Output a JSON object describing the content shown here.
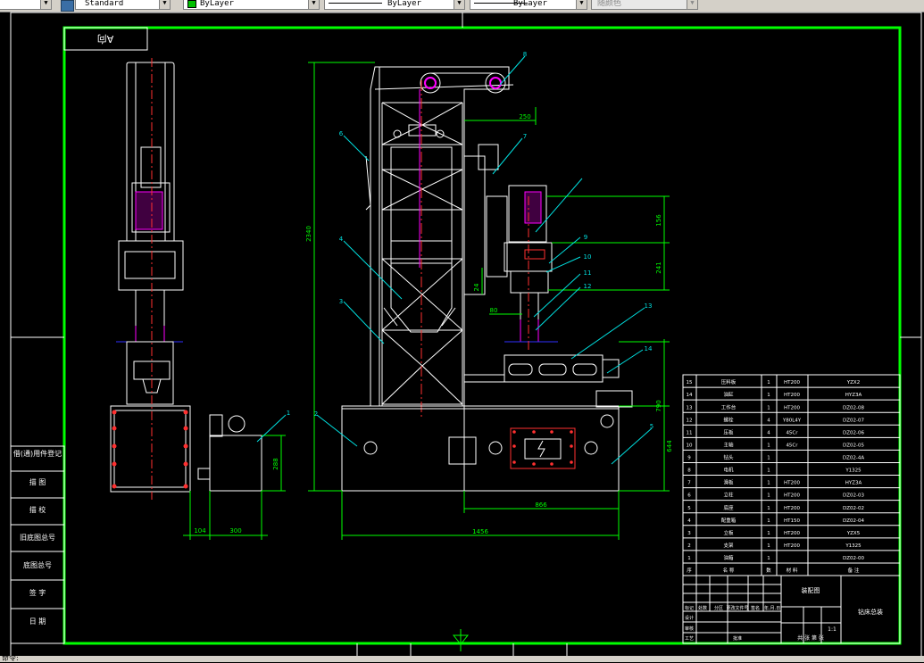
{
  "toolbar": {
    "left_combo": "",
    "text_style": "Standard",
    "layer": "ByLayer",
    "linetype": "ByLayer",
    "lineweight": "ByLayer",
    "plot_style": "随颜色"
  },
  "drawing": {
    "view_label": "A向",
    "part_callouts": [
      "1",
      "2",
      "3",
      "4",
      "5",
      "6",
      "7",
      "8",
      "9",
      "10",
      "11",
      "12",
      "13",
      "14"
    ],
    "dimensions": {
      "total_height": "2340",
      "upper_offset": "250",
      "dim_156": "156",
      "dim_241": "241",
      "dim_24": "24",
      "dim_80": "80",
      "dim_790": "790",
      "dim_644": "644",
      "dim_866": "866",
      "dim_1456": "1456",
      "dim_288": "288",
      "dim_104": "104",
      "dim_300": "300"
    },
    "revision_block": [
      "借(通)用件登记",
      "描 图",
      "描 校",
      "旧底图总号",
      "底图总号",
      "签 字",
      "日 期"
    ],
    "bom_rows": [
      {
        "no": "15",
        "name": "压料板",
        "qty": "1",
        "material": "HT200",
        "remark": "YZX2"
      },
      {
        "no": "14",
        "name": "油缸",
        "qty": "1",
        "material": "HT200",
        "remark": "HYZ3A"
      },
      {
        "no": "13",
        "name": "工作台",
        "qty": "1",
        "material": "HT200",
        "remark": "DZ02-08"
      },
      {
        "no": "12",
        "name": "螺栓",
        "qty": "4",
        "material": "Y80L4Y",
        "remark": "DZ02-07"
      },
      {
        "no": "11",
        "name": "压板",
        "qty": "4",
        "material": "45Cr",
        "remark": "DZ02-06"
      },
      {
        "no": "10",
        "name": "主轴",
        "qty": "1",
        "material": "45Cr",
        "remark": "DZ02-05"
      },
      {
        "no": "9",
        "name": "钻头",
        "qty": "1",
        "material": "",
        "remark": "DZ02-4A"
      },
      {
        "no": "8",
        "name": "电机",
        "qty": "1",
        "material": "",
        "remark": "Y1325"
      },
      {
        "no": "7",
        "name": "滑板",
        "qty": "1",
        "material": "HT200",
        "remark": "HYZ3A"
      },
      {
        "no": "6",
        "name": "立柱",
        "qty": "1",
        "material": "HT200",
        "remark": "DZ02-03"
      },
      {
        "no": "5",
        "name": "底座",
        "qty": "1",
        "material": "HT200",
        "remark": "DZ02-02"
      },
      {
        "no": "4",
        "name": "配重箱",
        "qty": "1",
        "material": "HT150",
        "remark": "DZ02-04"
      },
      {
        "no": "3",
        "name": "立板",
        "qty": "1",
        "material": "HT200",
        "remark": "YZX5"
      },
      {
        "no": "2",
        "name": "支架",
        "qty": "1",
        "material": "HT200",
        "remark": "Y1325"
      },
      {
        "no": "1",
        "name": "油箱",
        "qty": "1",
        "material": "",
        "remark": "DZ02-00"
      }
    ],
    "bom_header": {
      "no": "序",
      "name": "名 称",
      "qty": "数",
      "material": "材 料",
      "remark": "备 注"
    },
    "title_block": {
      "drawing_name": "装配图",
      "drawing_no": "钻床总装",
      "scale": "1:1",
      "sheet": "共 张 第 张",
      "header_labels": [
        "标记",
        "处数",
        "分区",
        "更改文件号",
        "签名",
        "年.月.日"
      ],
      "role_labels": [
        "设计",
        "审核",
        "工艺",
        "标准化",
        "批准"
      ]
    }
  },
  "status_bar": {
    "text": "命令:"
  },
  "colors": {
    "frame": "#00ff00",
    "object": "#ffffff",
    "dim": "#00ff00",
    "center": "#ff3030",
    "magenta": "#ff00ff",
    "callout": "#00e0e0"
  }
}
